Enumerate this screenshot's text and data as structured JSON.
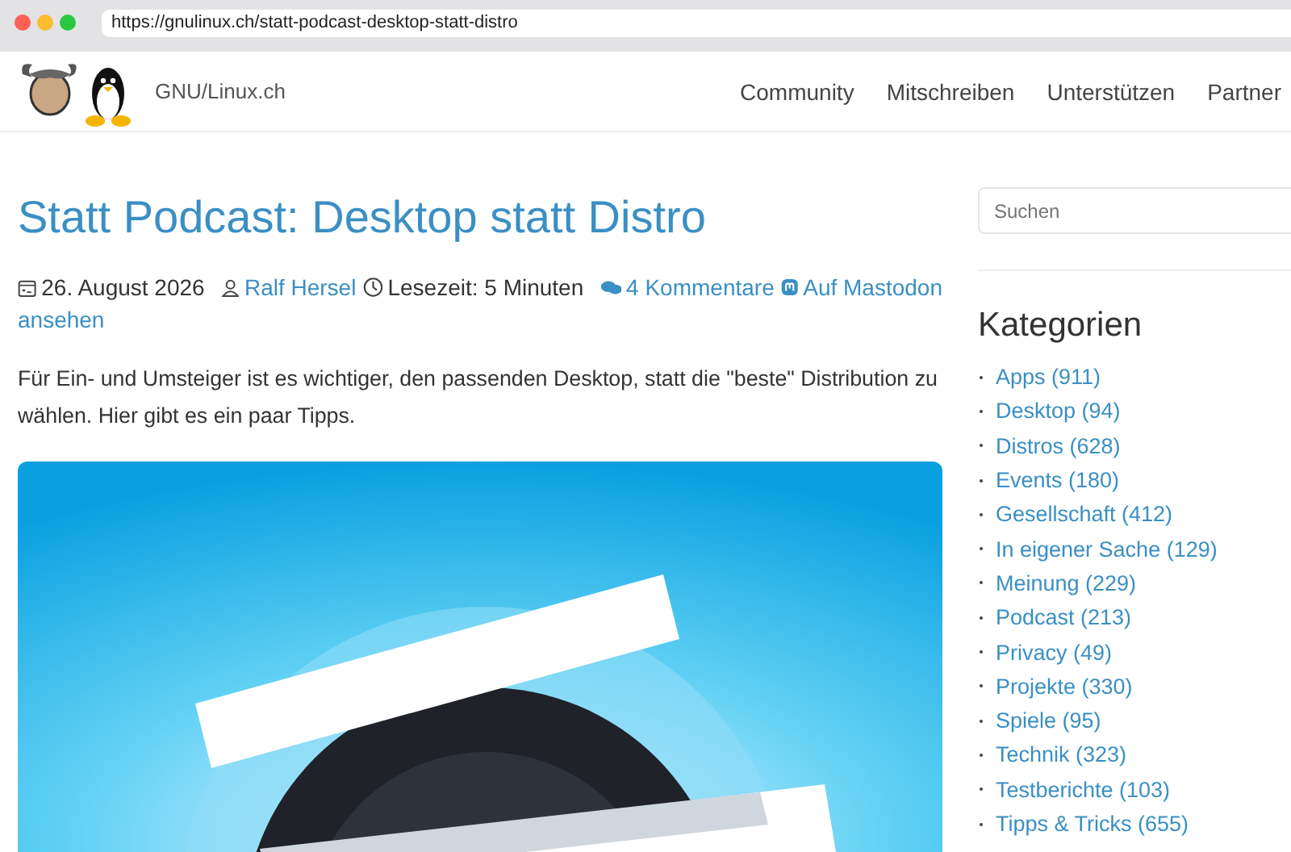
{
  "browser": {
    "url": "https://gnulinux.ch/statt-podcast-desktop-statt-distro"
  },
  "site": {
    "name": "GNU/Linux.ch"
  },
  "nav": [
    {
      "label": "Community"
    },
    {
      "label": "Mitschreiben"
    },
    {
      "label": "Unterstützen"
    },
    {
      "label": "Partner"
    }
  ],
  "article": {
    "title": "Statt Podcast: Desktop statt Distro",
    "date": "26. August 2026",
    "author": "Ralf Hersel",
    "reading_time": "Lesezeit: 5 Minuten",
    "comments": "4 Kommentare",
    "mastodon": "Auf Mastodon",
    "mastodon_cont": "ansehen",
    "lead": "Für Ein- und Umsteiger ist es wichtiger, den passenden Desktop, statt die \"beste\" Distribution zu wählen. Hier gibt es ein paar Tipps."
  },
  "sidebar": {
    "search": {
      "placeholder": "Suchen"
    },
    "heading": "Kategorien",
    "categories": [
      {
        "label": "Apps (911)"
      },
      {
        "label": "Desktop (94)"
      },
      {
        "label": "Distros (628)"
      },
      {
        "label": "Events (180)"
      },
      {
        "label": "Gesellschaft (412)"
      },
      {
        "label": "In eigener Sache (129)"
      },
      {
        "label": "Meinung (229)"
      },
      {
        "label": "Podcast (213)"
      },
      {
        "label": "Privacy (49)"
      },
      {
        "label": "Projekte (330)"
      },
      {
        "label": "Spiele (95)"
      },
      {
        "label": "Technik (323)"
      },
      {
        "label": "Testberichte (103)"
      },
      {
        "label": "Tipps & Tricks (655)"
      }
    ]
  }
}
